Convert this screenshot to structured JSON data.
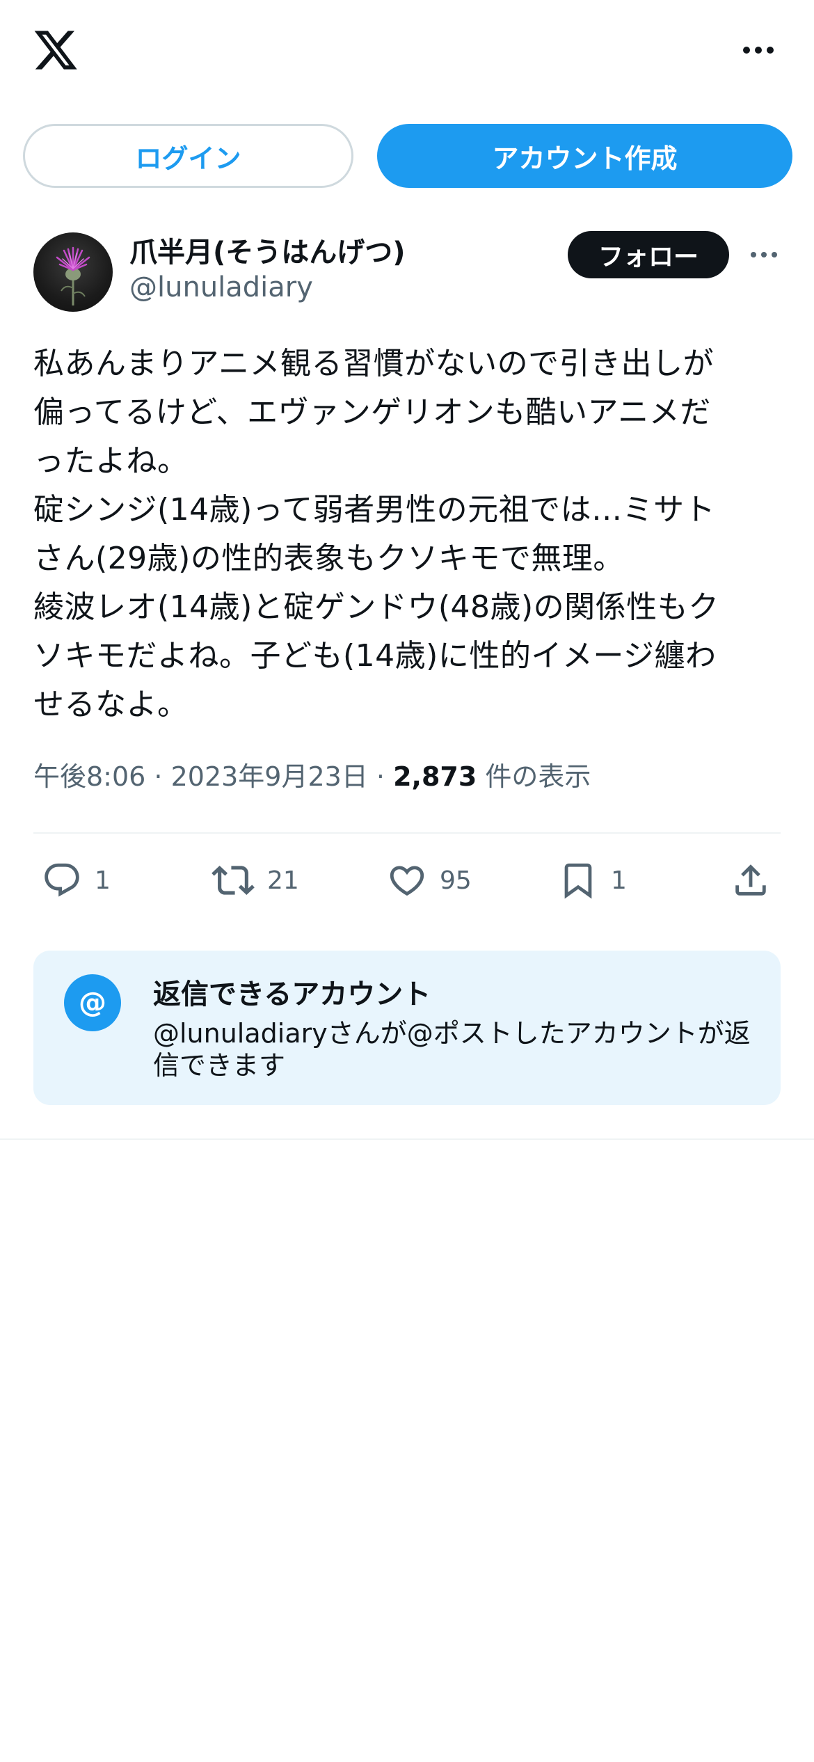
{
  "header": {
    "logo_icon": "x-logo-icon",
    "more_icon": "more-horizontal-icon"
  },
  "auth": {
    "login_label": "ログイン",
    "signup_label": "アカウント作成"
  },
  "author": {
    "display_name": "爪半月(そうはんげつ)",
    "handle": "@lunuladiary",
    "follow_label": "フォロー",
    "avatar_icon": "thistle-flower-avatar"
  },
  "tweet": {
    "text": "私あんまりアニメ観る習慣がないので引き出しが\n偏ってるけど、エヴァンゲリオンも酷いアニメだ\nったよね。\n碇シンジ(14歳)って弱者男性の元祖では…ミサト\nさん(29歳)の性的表象もクソキモで無理。\n綾波レオ(14歳)と碇ゲンドウ(48歳)の関係性もク\nソキモだよね。子ども(14歳)に性的イメージ纏わ\nせるなよ。",
    "time": "午後8:06",
    "sep1": " · ",
    "date": "2023年9月23日",
    "sep2": " · ",
    "views_count": "2,873",
    "views_label": " 件の表示"
  },
  "actions": {
    "reply": {
      "icon": "reply-icon",
      "count": "1"
    },
    "retweet": {
      "icon": "retweet-icon",
      "count": "21"
    },
    "like": {
      "icon": "heart-icon",
      "count": "95"
    },
    "bookmark": {
      "icon": "bookmark-icon",
      "count": "1"
    },
    "share": {
      "icon": "share-icon"
    }
  },
  "reply_restriction": {
    "icon_label": "@",
    "title": "返信できるアカウント",
    "description": "@lunuladiaryさんが@ポストしたアカウントが返信できます"
  },
  "colors": {
    "accent": "#1d9bf0",
    "text_primary": "#0f1419",
    "text_secondary": "#536471",
    "reply_box_bg": "#e8f5fd"
  }
}
